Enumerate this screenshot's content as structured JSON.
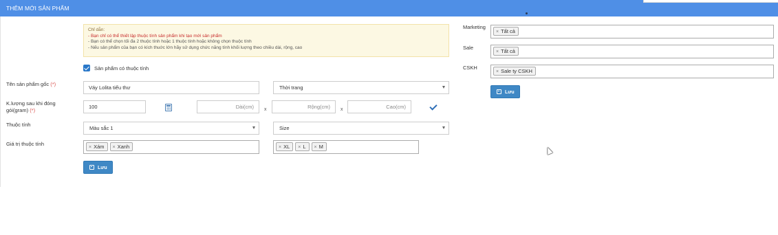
{
  "header": {
    "title": "THÊM MỚI SẢN PHẨM"
  },
  "hint": {
    "title": "Chỉ dẫn:",
    "lines": [
      "- Bạn chỉ có thể thiết lập thuộc tính sản phẩm khi tạo mới sản phẩm",
      "- Bạn có thể chọn tối đa 2 thuộc tính hoặc 1 thuộc tính hoặc không chọn thuộc tính",
      "- Nếu sản phẩm của bạn có kích thuớc lớn hãy sử dụng chức năng tính khối luợng theo chiều dài, rộng, cao"
    ]
  },
  "has_attributes": {
    "label": "Sản phẩm có thuộc tính",
    "checked": true
  },
  "product_name": {
    "label": "Tên sản phẩm gốc",
    "required": "(*)",
    "value": "Váy  Lolita tiểu thư",
    "category": "Thời trang"
  },
  "weight": {
    "label_line1": "K.lượng sau khi đóng",
    "label_line2": "gói(gram)",
    "required": "(*)",
    "value": "100",
    "length_placeholder": "Dài(cm)",
    "width_placeholder": "Rộng(cm)",
    "height_placeholder": "Cao(cm)",
    "x": "x"
  },
  "attributes": {
    "label": "Thuộc tính",
    "attr1": "Màu sắc 1",
    "attr2": "Size"
  },
  "attribute_values": {
    "label": "Giá trị thuộc tính",
    "values1": [
      "Xám",
      "Xanh"
    ],
    "values2": [
      "XL",
      "L",
      "M"
    ],
    "remove_symbol": "×"
  },
  "save_label": "Lưu",
  "right": {
    "marketing_label": "Marketing",
    "marketing_tags": [
      "Tất cả"
    ],
    "sale_label": "Sale",
    "sale_tags": [
      "Tất cả"
    ],
    "cskh_label": "CSKH",
    "cskh_tags": [
      "Sale ty CSKH"
    ],
    "save_label": "Lưu"
  },
  "colors": {
    "header": "#4f8fe6",
    "button": "#3f88c5",
    "hint_bg": "#fcf8e3",
    "hint_red": "#c72b2b"
  }
}
